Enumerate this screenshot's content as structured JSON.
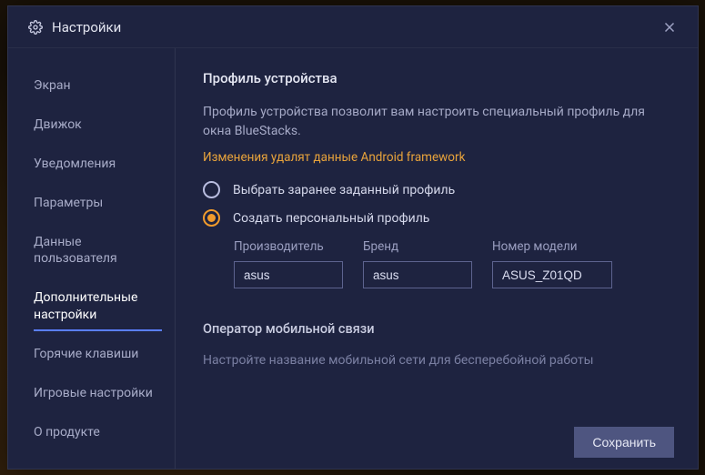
{
  "header": {
    "title": "Настройки"
  },
  "sidebar": {
    "items": [
      {
        "label": "Экран"
      },
      {
        "label": "Движок"
      },
      {
        "label": "Уведомления"
      },
      {
        "label": "Параметры"
      },
      {
        "label": "Данные пользователя"
      },
      {
        "label": "Дополнительные настройки",
        "active": true
      },
      {
        "label": "Горячие клавиши"
      },
      {
        "label": "Игровые настройки"
      },
      {
        "label": "О продукте"
      }
    ]
  },
  "content": {
    "device_profile": {
      "title": "Профиль устройства",
      "description": "Профиль устройства позволит вам настроить специальный профиль для окна BlueStacks.",
      "warning": "Изменения удалят данные Android framework",
      "options": {
        "predefined_label": "Выбрать заранее заданный профиль",
        "custom_label": "Создать персональный профиль",
        "selected": "custom"
      },
      "fields": {
        "manufacturer_label": "Производитель",
        "manufacturer_value": "asus",
        "brand_label": "Бренд",
        "brand_value": "asus",
        "model_label": "Номер модели",
        "model_value": "ASUS_Z01QD"
      }
    },
    "mobile_operator": {
      "title": "Оператор мобильной связи",
      "description": "Настройте название мобильной сети для бесперебойной работы"
    }
  },
  "actions": {
    "save_label": "Сохранить"
  }
}
